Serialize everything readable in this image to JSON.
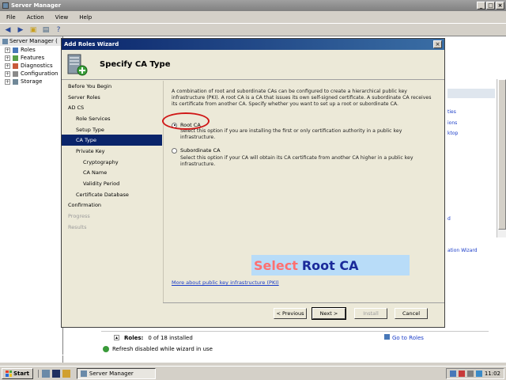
{
  "server_manager": {
    "title": "Server Manager",
    "menu": [
      "File",
      "Action",
      "View",
      "Help"
    ],
    "tree": {
      "root": "Server Manager (",
      "items": [
        "Roles",
        "Features",
        "Diagnostics",
        "Configuration",
        "Storage"
      ]
    },
    "right_links": [
      "ties",
      "ions",
      "ktop",
      "d",
      "ation Wizard"
    ],
    "roles_summary": {
      "label": "Roles:",
      "count": "0 of 18 installed",
      "goto_link": "Go to Roles"
    },
    "refresh_text": "Refresh disabled while wizard in use"
  },
  "wizard": {
    "window_title": "Add Roles Wizard",
    "page_title": "Specify CA Type",
    "nav": [
      {
        "label": "Before You Begin",
        "level": 0,
        "state": "normal"
      },
      {
        "label": "Server Roles",
        "level": 0,
        "state": "normal"
      },
      {
        "label": "AD CS",
        "level": 0,
        "state": "normal"
      },
      {
        "label": "Role Services",
        "level": 1,
        "state": "normal"
      },
      {
        "label": "Setup Type",
        "level": 1,
        "state": "normal"
      },
      {
        "label": "CA Type",
        "level": 1,
        "state": "active"
      },
      {
        "label": "Private Key",
        "level": 1,
        "state": "normal"
      },
      {
        "label": "Cryptography",
        "level": 2,
        "state": "normal"
      },
      {
        "label": "CA Name",
        "level": 2,
        "state": "normal"
      },
      {
        "label": "Validity Period",
        "level": 2,
        "state": "normal"
      },
      {
        "label": "Certificate Database",
        "level": 1,
        "state": "normal"
      },
      {
        "label": "Confirmation",
        "level": 0,
        "state": "normal"
      },
      {
        "label": "Progress",
        "level": 0,
        "state": "disabled"
      },
      {
        "label": "Results",
        "level": 0,
        "state": "disabled"
      }
    ],
    "intro": "A combination of root and subordinate CAs can be configured to create a hierarchical public key infrastructure (PKI). A root CA is a CA that issues its own self-signed certificate. A subordinate CA receives its certificate from another CA. Specify whether you want to set up a root or subordinate CA.",
    "options": {
      "root": {
        "label": "Root CA",
        "selected": true,
        "description": "Select this option if you are installing the first or only certification authority in a public key infrastructure."
      },
      "subordinate": {
        "label": "Subordinate CA",
        "selected": false,
        "description": "Select this option if your CA will obtain its CA certificate from another CA higher in a public key infrastructure."
      }
    },
    "learn_more": "More about public key infrastructure (PKI)",
    "buttons": {
      "previous": "< Previous",
      "next": "Next >",
      "install": "Install",
      "cancel": "Cancel"
    }
  },
  "caption": {
    "word1": "Select",
    "word2": "Root CA"
  },
  "taskbar": {
    "start": "Start",
    "task": "Server Manager",
    "clock": "11:02"
  },
  "colors": {
    "selection": "#0a246a",
    "annotation_circle": "#d01818",
    "caption_bg": "#b8dcf8",
    "caption_word1": "#ff7070",
    "caption_word2": "#1a2a9a",
    "link": "#1a3cc8"
  }
}
